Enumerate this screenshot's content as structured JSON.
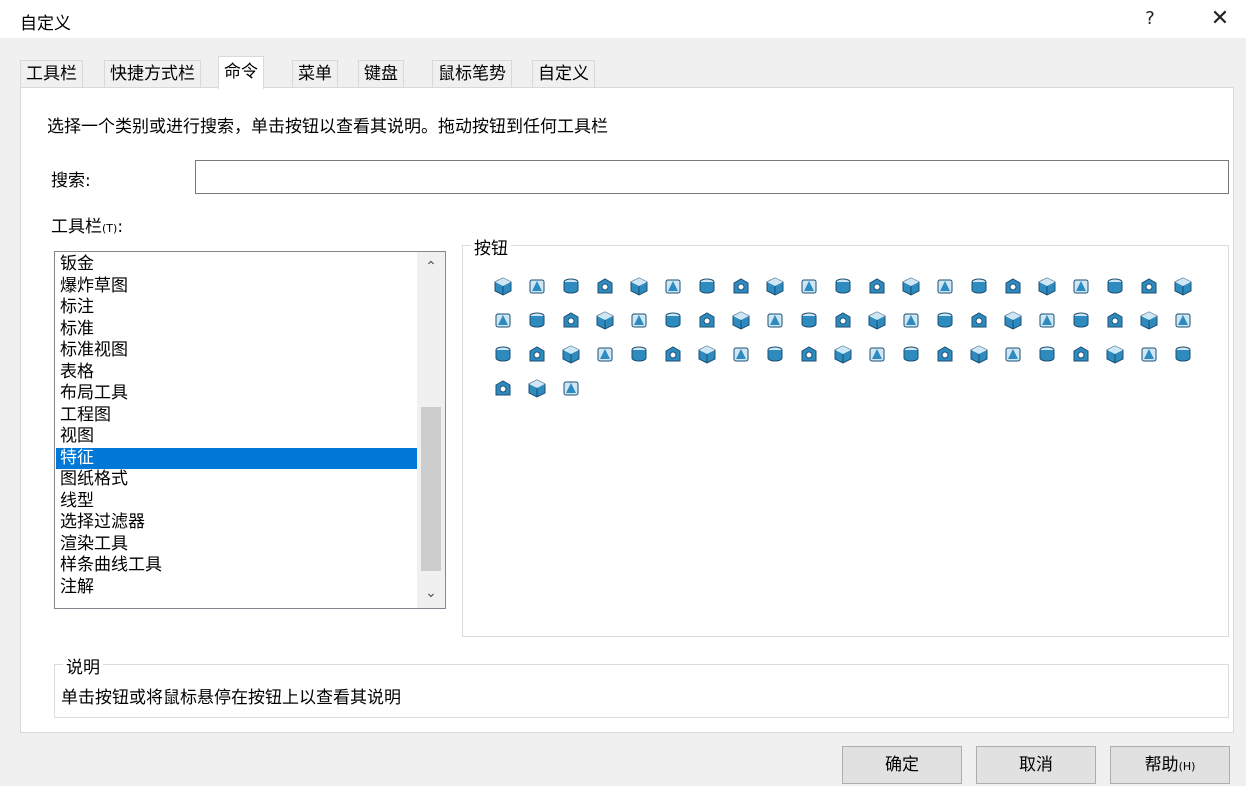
{
  "window": {
    "title": "自定义",
    "help_glyph": "?",
    "close_glyph": "✕"
  },
  "tabs": [
    {
      "label": "工具栏"
    },
    {
      "label": "快捷方式栏"
    },
    {
      "label": "命令",
      "active": true
    },
    {
      "label": "菜单"
    },
    {
      "label": "键盘"
    },
    {
      "label": "鼠标笔势"
    },
    {
      "label": "自定义"
    }
  ],
  "content": {
    "instruction": "选择一个类别或进行搜索，单击按钮以查看其说明。拖动按钮到任何工具栏",
    "search_label": "搜索:",
    "search_value": "",
    "toolbars_label": "工具栏",
    "toolbars_accel": "(T)",
    "toolbars_colon": ":",
    "categories": [
      "钣金",
      "爆炸草图",
      "标注",
      "标准",
      "标准视图",
      "表格",
      "布局工具",
      "工程图",
      "视图",
      "特征",
      "图纸格式",
      "线型",
      "选择过滤器",
      "渲染工具",
      "样条曲线工具",
      "注解"
    ],
    "selected_category": "特征",
    "buttons_label": "按钮",
    "description_label": "说明",
    "description_text": "单击按钮或将鼠标悬停在按钮上以查看其说明"
  },
  "feature_icons": [
    "extrude-boss-icon",
    "revolve-boss-icon",
    "sweep-boss-icon",
    "loft-boss-icon",
    "extrude-cut-icon",
    "revolve-cut-icon",
    "sweep-cut-icon",
    "loft-cut-icon",
    "boundary-boss-icon",
    "boundary-cut-icon",
    "fillet-icon",
    "chamfer-icon",
    "shell-icon",
    "rib-icon",
    "draft-icon",
    "dome-icon",
    "wrap-icon",
    "flex-icon",
    "deform-icon",
    "intersect-icon",
    "hole-wizard-icon",
    "advanced-hole-icon",
    "cosmetic-thread-icon",
    "thread-icon",
    "pin-icon",
    "stud-icon",
    "dome-solid-icon",
    "mounting-boss-icon",
    "vent-icon",
    "lip-groove-icon",
    "snap-hook-icon",
    "fastening-icon",
    "indent-icon",
    "scale-icon",
    "move-face-icon",
    "delete-face-icon",
    "replace-face-icon",
    "split-icon",
    "combine-icon",
    "linear-pattern-icon",
    "mirror-icon",
    "circular-pattern-icon",
    "curve-pattern-icon",
    "sketch-pattern-icon",
    "table-pattern-icon",
    "fill-pattern-icon",
    "variable-pattern-icon",
    "derived-pattern-icon",
    "thicken-icon",
    "thicken-cut-icon",
    "cut-with-surface-icon",
    "freeform-icon",
    "sheet-metal-icon",
    "sweep-thin-icon",
    "imported-icon",
    "body-delete-icon",
    "move-copy-icon",
    "feature-freeze-icon",
    "chain-pattern-icon",
    "instant3d-icon",
    "section-icon",
    "dimxpert-icon",
    "mold-icon",
    "rebuild-icon",
    "weldment-icon",
    "structure-icon"
  ],
  "colors": {
    "accent": "#0078d7",
    "icon_blue": "#2e8bc0",
    "icon_dark": "#1b4f72"
  },
  "footer": {
    "ok": "确定",
    "cancel": "取消",
    "help": "帮助",
    "help_accel": "(H)"
  }
}
